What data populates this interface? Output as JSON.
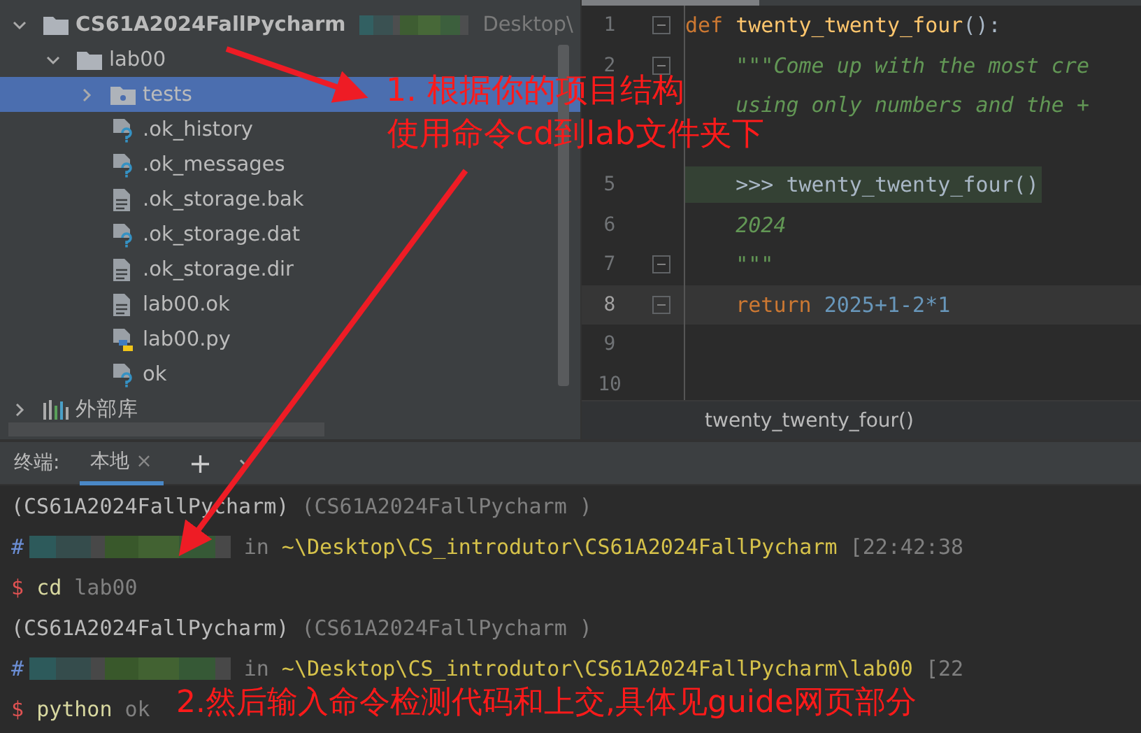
{
  "project_tree": {
    "items": [
      {
        "label": "CS61A2024FallPycharm",
        "kind": "folder",
        "expanded": true,
        "selected": false,
        "path": "Desktop\\",
        "children": [
          {
            "label": "lab00",
            "kind": "folder",
            "expanded": true,
            "selected": false,
            "children": [
              {
                "label": "tests",
                "kind": "package",
                "expanded": false,
                "selected": true
              },
              {
                "label": ".ok_history",
                "kind": "unknown",
                "selected": false
              },
              {
                "label": ".ok_messages",
                "kind": "unknown",
                "selected": false
              },
              {
                "label": ".ok_storage.bak",
                "kind": "text",
                "selected": false
              },
              {
                "label": ".ok_storage.dat",
                "kind": "unknown",
                "selected": false
              },
              {
                "label": ".ok_storage.dir",
                "kind": "text",
                "selected": false
              },
              {
                "label": "lab00.ok",
                "kind": "text",
                "selected": false
              },
              {
                "label": "lab00.py",
                "kind": "python",
                "selected": false
              },
              {
                "label": "ok",
                "kind": "unknown",
                "selected": false
              }
            ]
          }
        ]
      },
      {
        "label": "外部库",
        "kind": "library",
        "expanded": false,
        "selected": false
      }
    ]
  },
  "editor": {
    "lines": [
      {
        "number": "1",
        "current": false,
        "fold": true,
        "tokens": [
          {
            "kind": "keyword",
            "text": "def "
          },
          {
            "kind": "function",
            "text": "twenty_twenty_four"
          },
          {
            "kind": "plain",
            "text": "():"
          }
        ]
      },
      {
        "number": "2",
        "current": false,
        "fold": true,
        "tokens": [
          {
            "kind": "docstring",
            "text": "    \"\"\"Come up with the most cre"
          }
        ]
      },
      {
        "fold": false,
        "tokens": [
          {
            "kind": "docstring",
            "text": "    using only numbers and the +"
          }
        ]
      },
      {
        "fold": false
      },
      {
        "number": "5",
        "current": false,
        "fold": false,
        "tokens": [
          {
            "kind": "doctest",
            "text": "    >>> twenty_twenty_four()"
          }
        ]
      },
      {
        "number": "6",
        "current": false,
        "fold": false,
        "tokens": [
          {
            "kind": "docstring",
            "text": "    2024"
          }
        ]
      },
      {
        "number": "7",
        "current": false,
        "fold": true,
        "tokens": [
          {
            "kind": "docstring",
            "text": "    \"\"\""
          }
        ]
      },
      {
        "number": "8",
        "current": true,
        "fold": true,
        "tokens": [
          {
            "kind": "keyword",
            "text": "    return "
          },
          {
            "kind": "number",
            "text": "2025+1-2*1"
          }
        ]
      },
      {
        "number": "9",
        "current": false,
        "fold": false
      },
      {
        "number": "10",
        "current": false,
        "fold": false
      }
    ],
    "breadcrumb": "twenty_twenty_four()"
  },
  "terminal": {
    "label": "终端:",
    "tabs": [
      {
        "label": "本地",
        "close": "×",
        "selected": true
      }
    ],
    "add": "+",
    "lines": [
      {
        "segments": [
          {
            "kind": "plain",
            "text": "(CS61A2024FallPycharm) "
          },
          {
            "kind": "dim",
            "text": "(CS61A2024FallPycharm )"
          }
        ]
      },
      {
        "segments": [
          {
            "kind": "hash",
            "text": "#"
          },
          {
            "kind": "blurred"
          },
          {
            "kind": "dim",
            "text": " in "
          },
          {
            "kind": "path",
            "text": "~\\Desktop\\CS_introdutor\\CS61A2024FallPycharm"
          },
          {
            "kind": "dim",
            "text": " [22:42:38"
          }
        ]
      },
      {
        "segments": [
          {
            "kind": "dollar",
            "text": "$ "
          },
          {
            "kind": "command",
            "text": "cd "
          },
          {
            "kind": "dim",
            "text": "lab00"
          }
        ]
      },
      {
        "segments": [
          {
            "kind": "plain",
            "text": "(CS61A2024FallPycharm) "
          },
          {
            "kind": "dim",
            "text": "(CS61A2024FallPycharm )"
          }
        ]
      },
      {
        "segments": [
          {
            "kind": "hash",
            "text": "#"
          },
          {
            "kind": "blurred"
          },
          {
            "kind": "dim",
            "text": " in "
          },
          {
            "kind": "path",
            "text": "~\\Desktop\\CS_introdutor\\CS61A2024FallPycharm\\lab00"
          },
          {
            "kind": "dim",
            "text": " [22"
          }
        ]
      },
      {
        "segments": [
          {
            "kind": "dollar",
            "text": "$ "
          },
          {
            "kind": "command",
            "text": "python "
          },
          {
            "kind": "dim",
            "text": "ok"
          }
        ]
      }
    ]
  },
  "annotations": [
    "1. 根据你的项目结构",
    "使用命令cd到lab文件夹下",
    "2.然后输入命令检测代码和上交,具体见guide网页部分"
  ]
}
